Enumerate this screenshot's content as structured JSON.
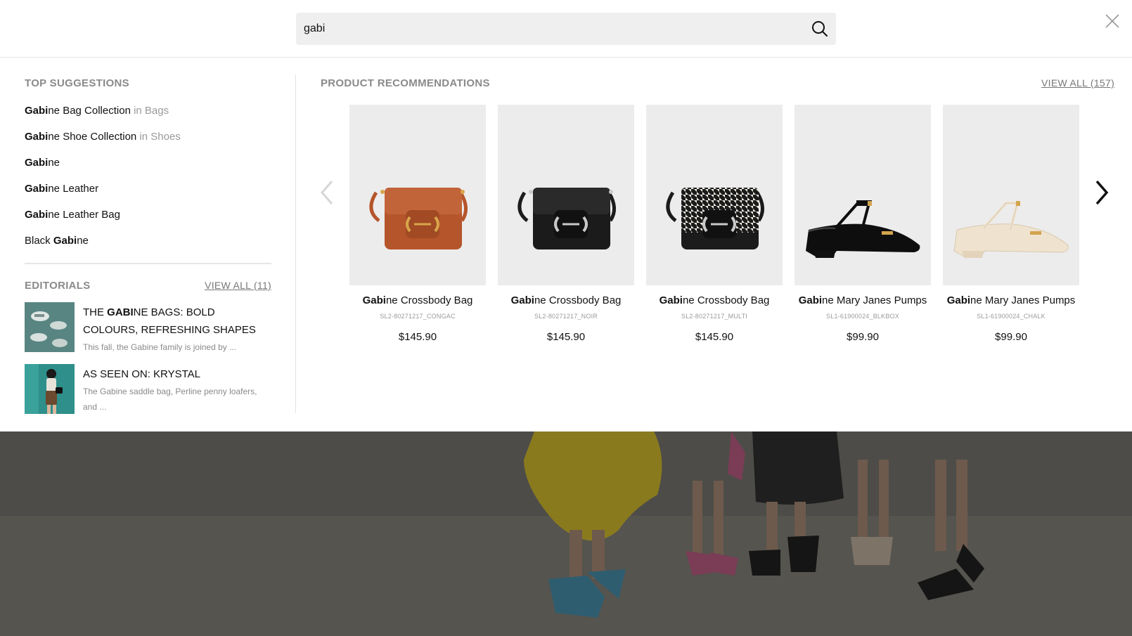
{
  "search": {
    "value": "gabi",
    "query_highlight": "Gabi"
  },
  "suggestions": {
    "title": "TOP SUGGESTIONS",
    "items": [
      {
        "match": "Gabi",
        "rest": "ne Bag Collection",
        "in_text": " in Bags"
      },
      {
        "match": "Gabi",
        "rest": "ne Shoe Collection",
        "in_text": " in Shoes"
      },
      {
        "match": "Gabi",
        "rest": "ne",
        "in_text": ""
      },
      {
        "match": "Gabi",
        "rest": "ne Leather",
        "in_text": ""
      },
      {
        "match": "Gabi",
        "rest": "ne Leather Bag",
        "in_text": ""
      },
      {
        "prefix": "Black ",
        "match": "Gabi",
        "rest": "ne",
        "in_text": ""
      }
    ]
  },
  "editorials": {
    "title": "EDITORIALS",
    "view_all": "VIEW ALL (11)",
    "items": [
      {
        "headline_pre": "THE ",
        "headline_match": "GABI",
        "headline_post": "NE BAGS: BOLD COLOURS, REFRESHING SHAPES",
        "desc": "This fall, the Gabine family is joined by ..."
      },
      {
        "headline_pre": "AS SEEN ON: KRYSTAL",
        "headline_match": "",
        "headline_post": "",
        "desc": "The Gabine saddle bag, Perline penny loafers, and ..."
      }
    ]
  },
  "products": {
    "title": "PRODUCT RECOMMENDATIONS",
    "view_all": "VIEW ALL (157)",
    "items": [
      {
        "match": "Gabi",
        "rest": "ne Crossbody Bag",
        "sku": "SL2-80271217_CONGAC",
        "price": "$145.90",
        "kind": "bag",
        "color": "#b5552b",
        "hardware": "#d9a54a"
      },
      {
        "match": "Gabi",
        "rest": "ne Crossbody Bag",
        "sku": "SL2-80271217_NOIR",
        "price": "$145.90",
        "kind": "bag",
        "color": "#1b1b1b",
        "hardware": "#c9c9c9"
      },
      {
        "match": "Gabi",
        "rest": "ne Crossbody Bag",
        "sku": "SL2-80271217_MULTI",
        "price": "$145.90",
        "kind": "bag-houndstooth",
        "color": "#1b1b1b",
        "hardware": "#c9c9c9"
      },
      {
        "match": "Gabi",
        "rest": "ne Mary Janes Pumps",
        "sku": "SL1-61900024_BLKBOX",
        "price": "$99.90",
        "kind": "shoe",
        "color": "#0e0e0e",
        "hardware": "#d3a44d"
      },
      {
        "match": "Gabi",
        "rest": "ne Mary Janes Pumps",
        "sku": "SL1-61900024_CHALK",
        "price": "$99.90",
        "kind": "shoe",
        "color": "#efe3cf",
        "hardware": "#d3a44d"
      }
    ]
  },
  "colors": {
    "search_bg": "#efefef",
    "caret": "#1a6fe0",
    "muted": "#8a8a8a",
    "overlay": "#4d4c48"
  }
}
